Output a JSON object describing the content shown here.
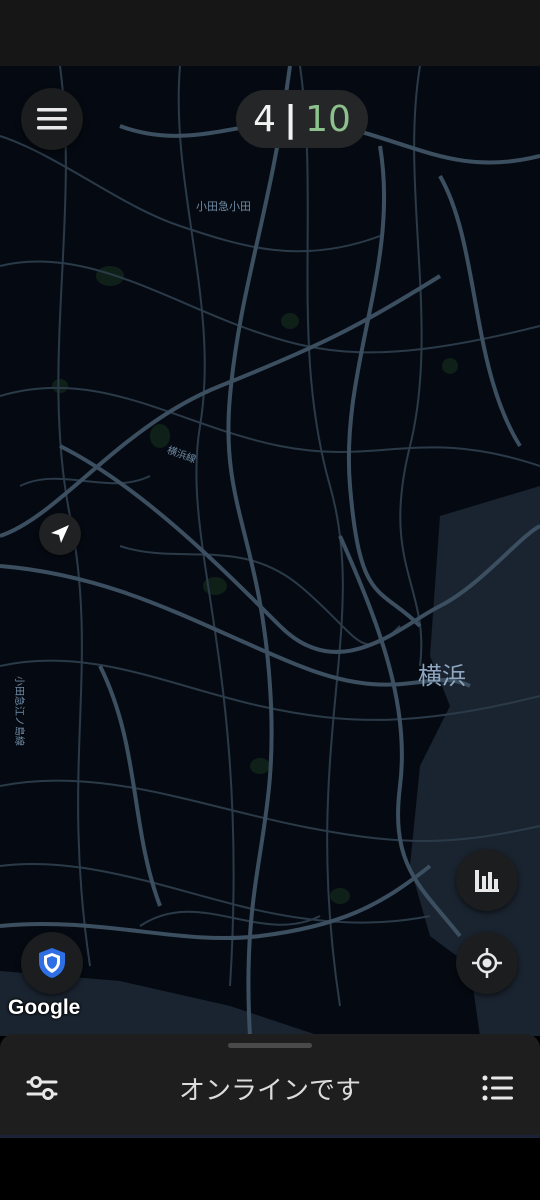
{
  "counter": {
    "current": "4",
    "separator": "|",
    "total": "10"
  },
  "map": {
    "city_label": "横浜",
    "line_label_1": "小田急小田",
    "line_label_2": "横浜線",
    "line_label_3": "小田急江ノ島線",
    "attribution": "Google"
  },
  "bottom_sheet": {
    "status": "オンラインです"
  },
  "icons": {
    "menu": "hamburger-icon",
    "stats": "bar-chart-icon",
    "locate": "crosshair-icon",
    "shield": "shield-icon",
    "filter": "sliders-icon",
    "list": "list-icon",
    "nav": "navigation-arrow-icon"
  },
  "colors": {
    "accent_green": "#8cc08c",
    "shield_blue": "#2f6fe6",
    "map_background": "#050a12",
    "road": "#3c4f60"
  }
}
